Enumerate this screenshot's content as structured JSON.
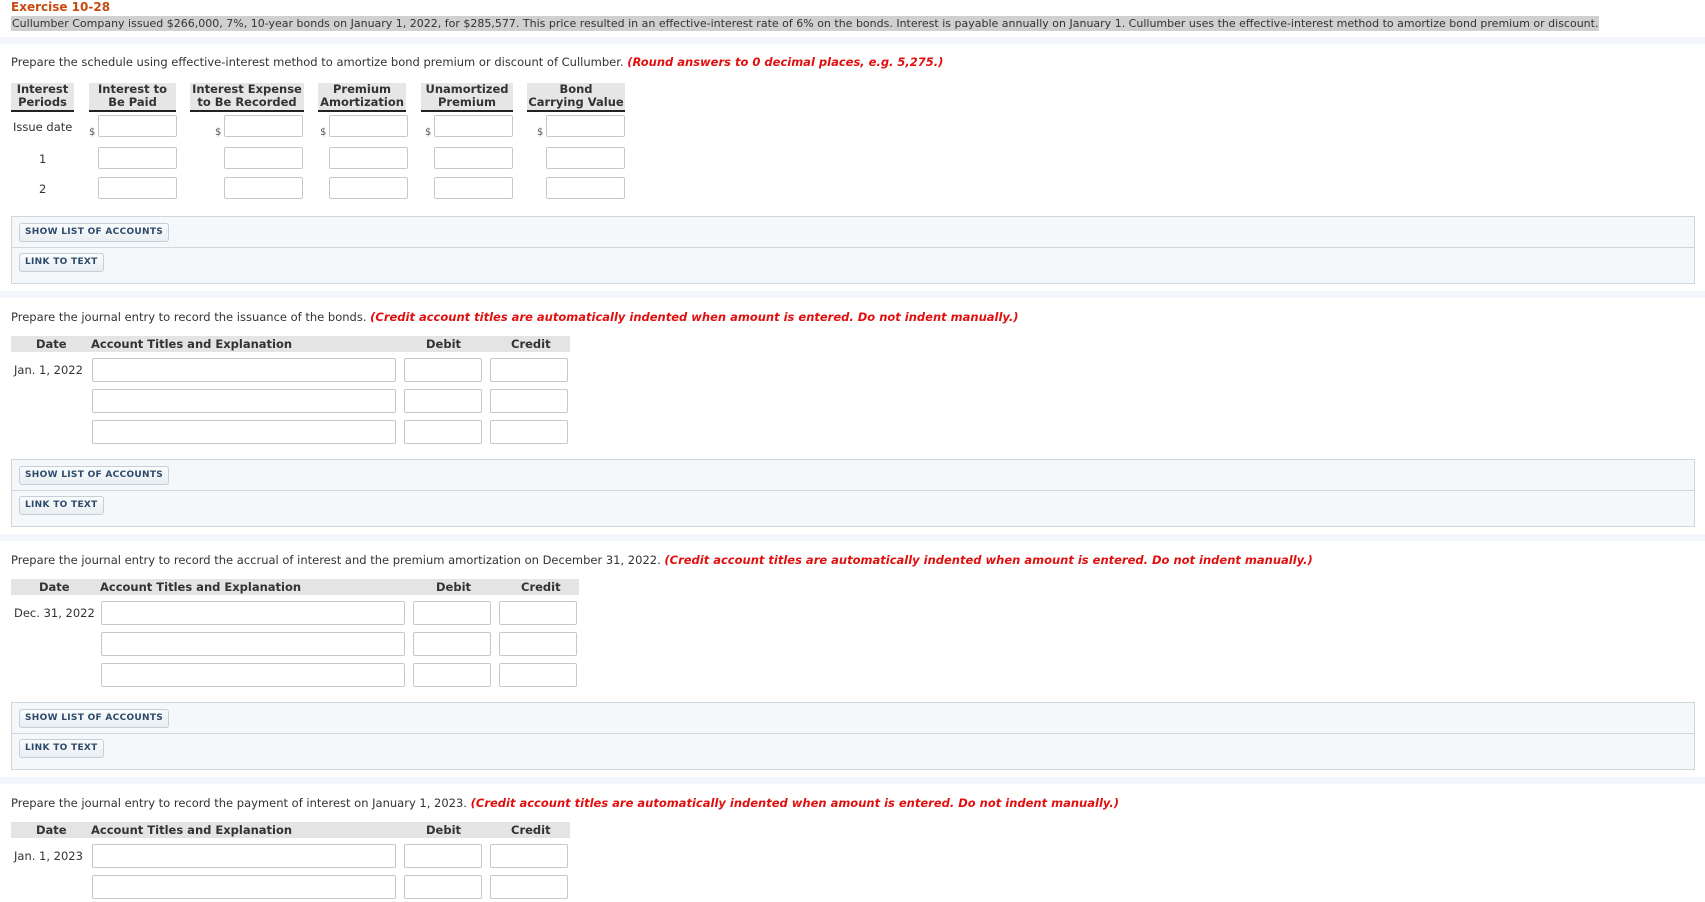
{
  "exercise": {
    "title": "Exercise 10-28",
    "problem": "Cullumber Company issued $266,000, 7%, 10-year bonds on January 1, 2022, for $285,577. This price resulted in an effective-interest rate of 6% on the bonds. Interest is payable annually on January 1. Cullumber uses the effective-interest method to amortize bond premium or discount."
  },
  "colors": {
    "title": "#c84a10",
    "note": "#e01010",
    "button_text": "#2e4a6b"
  },
  "schedule": {
    "prompt": "Prepare the schedule using effective-interest method to amortize bond premium or discount of Cullumber.",
    "note": "(Round answers to 0 decimal places, e.g. 5,275.)",
    "headers": [
      {
        "line1": "Interest",
        "line2": "Periods"
      },
      {
        "line1": "Interest to",
        "line2": "Be Paid"
      },
      {
        "line1": "Interest Expense",
        "line2": "to Be Recorded"
      },
      {
        "line1": "Premium",
        "line2": "Amortization"
      },
      {
        "line1": "Unamortized",
        "line2": "Premium"
      },
      {
        "line1": "Bond",
        "line2": "Carrying Value"
      }
    ],
    "currency_symbol": "$",
    "rows": [
      {
        "label": "Issue date",
        "values": [
          "",
          "",
          "",
          "",
          ""
        ]
      },
      {
        "label": "1",
        "values": [
          "",
          "",
          "",
          "",
          ""
        ]
      },
      {
        "label": "2",
        "values": [
          "",
          "",
          "",
          "",
          ""
        ]
      }
    ]
  },
  "buttons": {
    "show_accounts": "SHOW LIST OF ACCOUNTS",
    "link_text": "LINK TO TEXT"
  },
  "journal_headers": {
    "date": "Date",
    "account": "Account Titles and Explanation",
    "debit": "Debit",
    "credit": "Credit"
  },
  "journals": [
    {
      "prompt": "Prepare the journal entry to record the issuance of the bonds.",
      "note": "(Credit account titles are automatically indented when amount is entered. Do not indent manually.)",
      "date": "Jan. 1, 2022",
      "rows": [
        {
          "account": "",
          "debit": "",
          "credit": ""
        },
        {
          "account": "",
          "debit": "",
          "credit": ""
        },
        {
          "account": "",
          "debit": "",
          "credit": ""
        }
      ]
    },
    {
      "prompt": "Prepare the journal entry to record the accrual of interest and the premium amortization on December 31, 2022.",
      "note": "(Credit account titles are automatically indented when amount is entered. Do not indent manually.)",
      "date": "Dec. 31, 2022",
      "rows": [
        {
          "account": "",
          "debit": "",
          "credit": ""
        },
        {
          "account": "",
          "debit": "",
          "credit": ""
        },
        {
          "account": "",
          "debit": "",
          "credit": ""
        }
      ]
    },
    {
      "prompt": "Prepare the journal entry to record the payment of interest on January 1, 2023.",
      "note": "(Credit account titles are automatically indented when amount is entered. Do not indent manually.)",
      "date": "Jan. 1, 2023",
      "rows": [
        {
          "account": "",
          "debit": "",
          "credit": ""
        },
        {
          "account": "",
          "debit": "",
          "credit": ""
        }
      ]
    }
  ]
}
